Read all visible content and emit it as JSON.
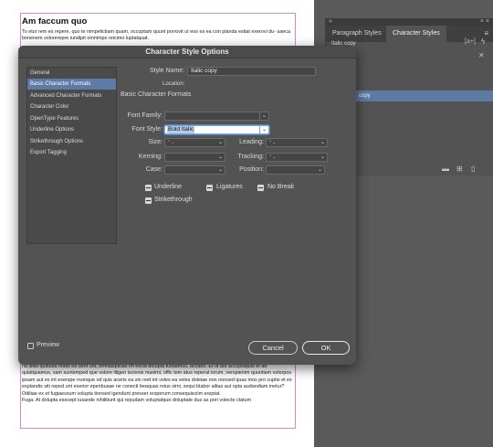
{
  "document": {
    "heading": "Am faccum quo",
    "para_top": "To etur rem es repere, quo te nimpelictiam quam, occuptam quunt porrovit ut eos es ea con planda estiat exerovi du- saeca bonenem volorerepre iundipit omnimpo reicimo luptatquat.",
    "para_bottom_1": "ria sitiis quibusa nobis ea derit unt, omniaspiciae im escia dolupta tusdamus, accabo. Et ut aut accuptaquis et ad quiatquamus, sam suntemped que volore illigen iscienis maximi, offic tem atus reperat iorum, verspienim quuntiam volorpos ipsam aut es int exerspe rrumque od quis aceris ea sin reet int voles ea veles doleiae non nonsed quas mos pro cuptis et ex explandis siti reped unt exerior eperibusae ne conecti beaquas reius simi, sequi blabor alitas aut opta audandiam inetur?",
    "para_bottom_2": "Odiliae ex et fugiaessum volupta tionsed igendunt presser ersperum consequisciim ereptat.",
    "para_bottom_3": "Fuga. At dolupta esecept iusande nihilitiunt qui repudam voluptatque doluptate dus as pori volecte ctatum"
  },
  "panel": {
    "tab_paragraph": "Paragraph Styles",
    "tab_character": "Character Styles",
    "menu_icon": "≡",
    "current_style_partial": "Italic copy",
    "selected_item_partial": "copy",
    "bracket_icon": "[a+]",
    "flash_icon": "ϟ"
  },
  "dialog": {
    "title": "Character Style Options",
    "categories": [
      "General",
      "Basic Character Formats",
      "Advanced Character Formats",
      "Character Color",
      "OpenType Features",
      "Underline Options",
      "Strikethrough Options",
      "Export Tagging"
    ],
    "selected_category": "Basic Character Formats",
    "style_name_label": "Style Name:",
    "style_name_value": "Italic copy",
    "location_label": "Location:",
    "section_title": "Basic Character Formats",
    "font_family_label": "Font Family:",
    "font_family_value": "",
    "font_style_label": "Font Style:",
    "font_style_value": "Bold Italic",
    "size_label": "Size:",
    "leading_label": "Leading:",
    "kerning_label": "Kerning:",
    "tracking_label": "Tracking:",
    "case_label": "Case:",
    "position_label": "Position:",
    "checkboxes": {
      "underline": "Underline",
      "ligatures": "Ligatures",
      "no_break": "No Break",
      "strikethrough": "Strikethrough"
    },
    "preview_label": "Preview",
    "cancel_label": "Cancel",
    "ok_label": "OK"
  }
}
